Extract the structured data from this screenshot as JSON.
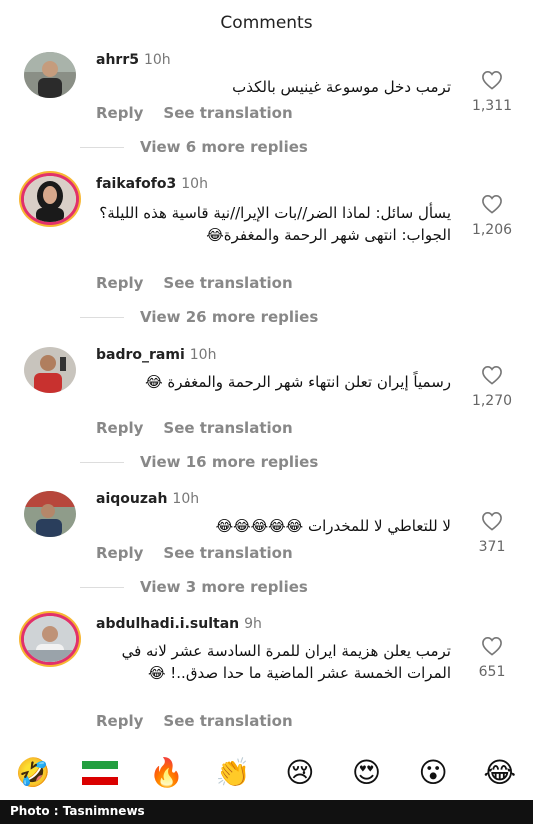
{
  "header": {
    "title": "Comments"
  },
  "comments": [
    {
      "username": "ahrr5",
      "time": "10h",
      "text": "ترمب دخل موسوعة غينيس بالكذب",
      "reply": "Reply",
      "translate": "See translation",
      "likes": "1,311",
      "more": "View 6 more replies"
    },
    {
      "username": "faikafofo3",
      "time": "10h",
      "text": "يسأل سائل: لماذا الضر//بات الإيرا//نية قاسية هذه الليلة؟ الجواب: انتهى شهر الرحمة والمغفرة😂",
      "reply": "Reply",
      "translate": "See translation",
      "likes": "1,206",
      "more": "View 26 more replies"
    },
    {
      "username": "badro_rami",
      "time": "10h",
      "text": "رسمياً إيران تعلن انتهاء شهر الرحمة والمغفرة 😂",
      "reply": "Reply",
      "translate": "See translation",
      "likes": "1,270",
      "more": "View 16 more replies"
    },
    {
      "username": "aiqouzah",
      "time": "10h",
      "text": "لا للتعاطي لا للمخدرات 😂😂😂😂😂",
      "reply": "Reply",
      "translate": "See translation",
      "likes": "371",
      "more": "View 3 more replies"
    },
    {
      "username": "abdulhadi.i.sultan",
      "time": "9h",
      "text": "ترمب يعلن هزيمة ايران للمرة السادسة عشر لانه في المرات الخمسة عشر الماضية ما حدا صدق..! 😂",
      "reply": "Reply",
      "translate": "See translation",
      "likes": "651"
    }
  ],
  "reactions": [
    "🤣",
    "🔥",
    "👏",
    "😢",
    "😍",
    "😮",
    "😂"
  ],
  "footer": {
    "credit": "Photo : Tasnimnews"
  }
}
